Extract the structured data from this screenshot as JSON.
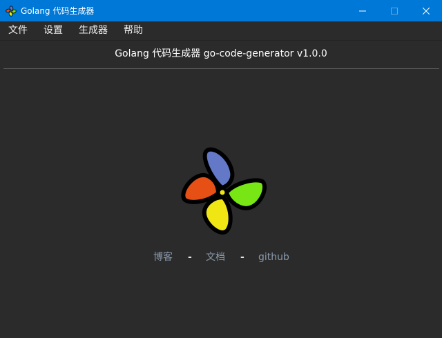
{
  "window": {
    "title": "Golang 代码生成器"
  },
  "menu": {
    "items": [
      {
        "label": "文件"
      },
      {
        "label": "设置"
      },
      {
        "label": "生成器"
      },
      {
        "label": "帮助"
      }
    ]
  },
  "header": {
    "title": "Golang 代码生成器 go-code-generator v1.0.0"
  },
  "links": {
    "blog": "博客",
    "docs": "文档",
    "github": "github",
    "separator": "-"
  },
  "colors": {
    "titlebar": "#0078d7",
    "background": "#2b2b2b",
    "link": "#8a9aac",
    "petal_blue": "#6478c8",
    "petal_green": "#78e614",
    "petal_yellow": "#f0e614",
    "petal_red": "#e65014"
  }
}
